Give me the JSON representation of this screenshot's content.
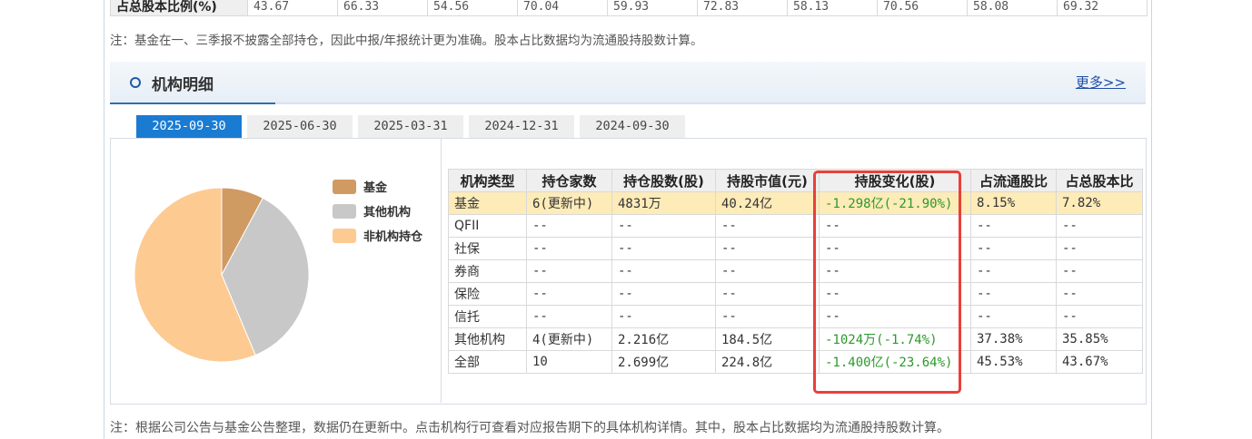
{
  "top_table": {
    "label": "占总股本比例(%)",
    "values": [
      "43.67",
      "66.33",
      "54.56",
      "70.04",
      "59.93",
      "72.83",
      "58.13",
      "70.56",
      "58.08",
      "69.32"
    ]
  },
  "note_top": "注：基金在一、三季报不披露全部持仓，因此中报/年报统计更为准确。股本占比数据均为流通股持股数计算。",
  "section": {
    "title": "机构明细",
    "more_link": "更多>>"
  },
  "tabs": [
    {
      "label": "2025-09-30",
      "active": true
    },
    {
      "label": "2025-06-30",
      "active": false
    },
    {
      "label": "2025-03-31",
      "active": false
    },
    {
      "label": "2024-12-31",
      "active": false
    },
    {
      "label": "2024-09-30",
      "active": false
    }
  ],
  "chart_data": {
    "type": "pie",
    "labels": [
      "基金",
      "其他机构",
      "非机构持仓"
    ],
    "values": [
      7.82,
      35.85,
      56.33
    ],
    "colors": [
      "#d09a63",
      "#c8c8c8",
      "#fdca92"
    ]
  },
  "table": {
    "headers": [
      "机构类型",
      "持仓家数",
      "持仓股数(股)",
      "持股市值(元)",
      "持股变化(股)",
      "占流通股比",
      "占总股本比"
    ],
    "rows": [
      [
        "基金",
        "6(更新中)",
        "4831万",
        "40.24亿",
        "-1.298亿(-21.90%)",
        "8.15%",
        "7.82%"
      ],
      [
        "QFII",
        "--",
        "--",
        "--",
        "--",
        "--",
        "--"
      ],
      [
        "社保",
        "--",
        "--",
        "--",
        "--",
        "--",
        "--"
      ],
      [
        "券商",
        "--",
        "--",
        "--",
        "--",
        "--",
        "--"
      ],
      [
        "保险",
        "--",
        "--",
        "--",
        "--",
        "--",
        "--"
      ],
      [
        "信托",
        "--",
        "--",
        "--",
        "--",
        "--",
        "--"
      ],
      [
        "其他机构",
        "4(更新中)",
        "2.216亿",
        "184.5亿",
        "-1024万(-1.74%)",
        "37.38%",
        "35.85%"
      ],
      [
        "全部",
        "10",
        "2.699亿",
        "224.8亿",
        "-1.400亿(-23.64%)",
        "45.53%",
        "43.67%"
      ]
    ],
    "highlight_row": 0,
    "accent_green": "#2a9a2a",
    "highlight_color": "#fdebb8",
    "annotation_color": "#e8403a"
  },
  "note_bottom": "注：根据公司公告与基金公告整理，数据仍在更新中。点击机构行可查看对应报告期下的具体机构详情。其中，股本占比数据均为流通股持股数计算。"
}
